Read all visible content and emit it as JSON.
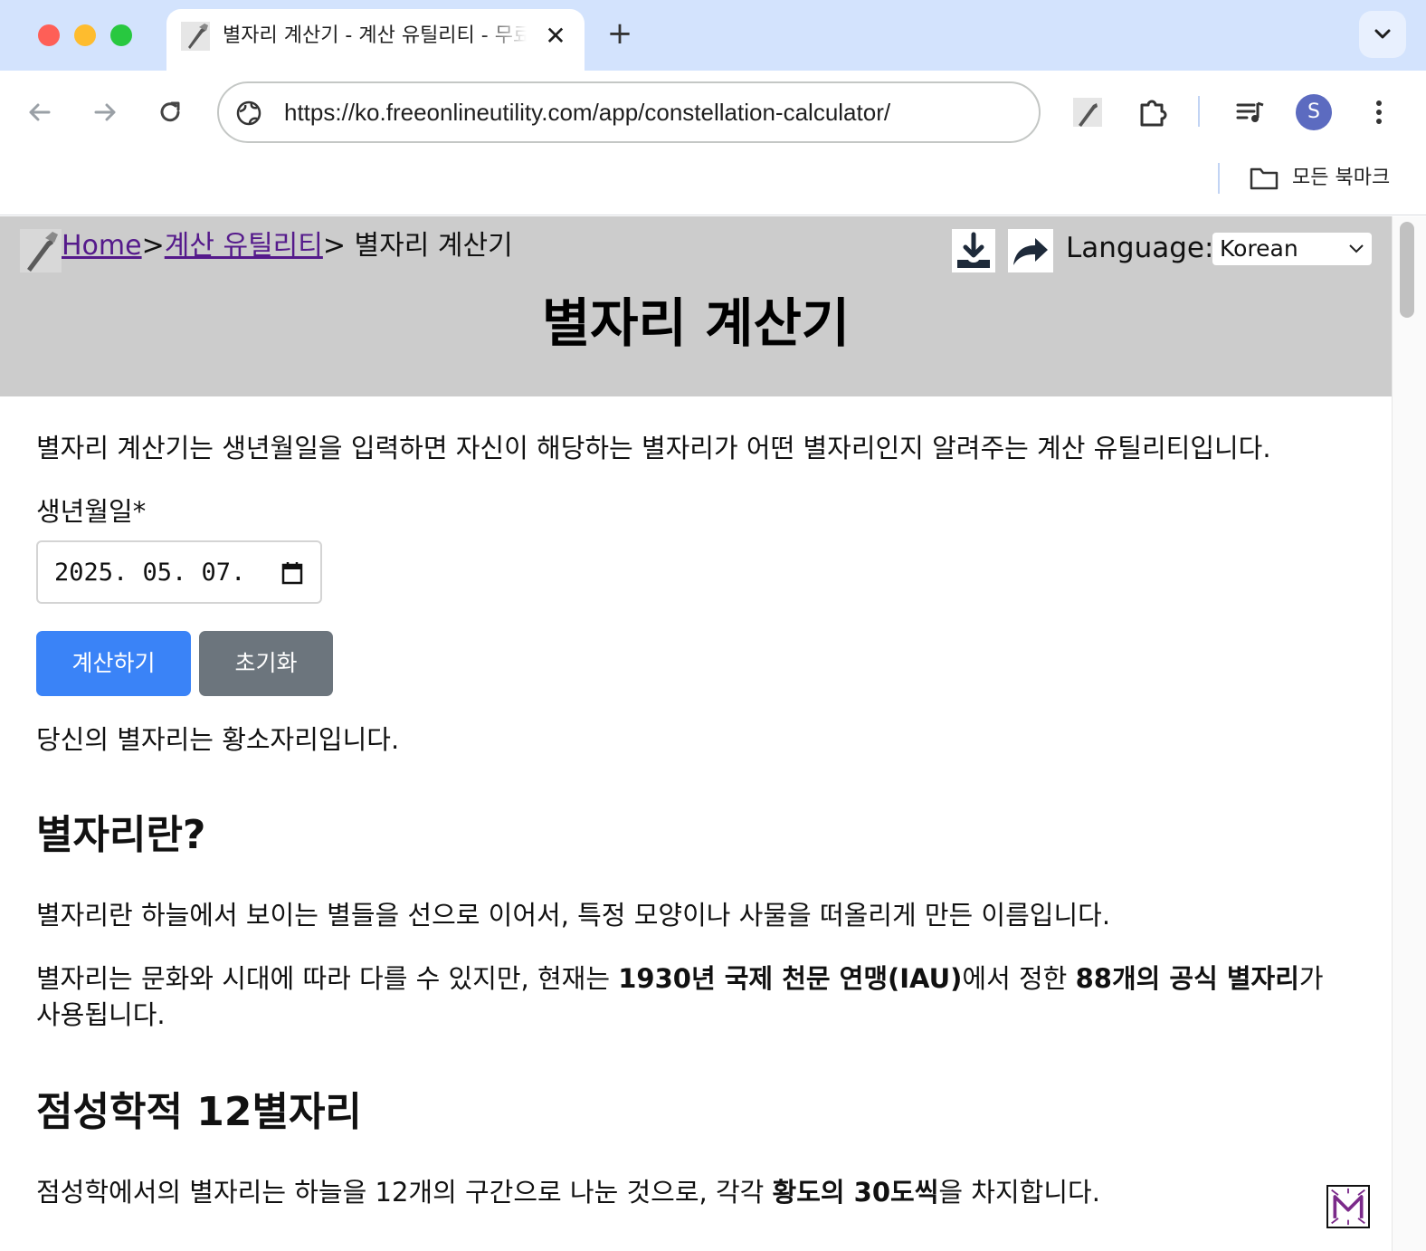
{
  "browser": {
    "tab_title": "별자리 계산기 - 계산 유틸리티 - 무료",
    "new_tab_label": "+",
    "close_label": "✕",
    "url": "https://ko.freeonlineutility.com/app/constellation-calculator/",
    "avatar_letter": "S",
    "bookmarks_label": "모든 북마크"
  },
  "header": {
    "breadcrumb_home": "Home",
    "breadcrumb_sep1": ">",
    "breadcrumb_category": "계산 유틸리티",
    "breadcrumb_current": "> 별자리 계산기",
    "language_label": "Language:",
    "language_value": "Korean",
    "page_title": "별자리 계산기"
  },
  "main": {
    "intro": "별자리 계산기는 생년월일을 입력하면 자신이 해당하는 별자리가 어떤 별자리인지 알려주는 계산 유틸리티입니다.",
    "birthdate_label": "생년월일*",
    "birthdate_value": "2025. 05. 07.",
    "calculate_button": "계산하기",
    "reset_button": "초기화",
    "result": "당신의 별자리는 황소자리입니다.",
    "section1_title": "별자리란?",
    "section1_p1": "별자리란 하늘에서 보이는 별들을 선으로 이어서, 특정 모양이나 사물을 떠올리게 만든 이름입니다.",
    "section1_p2_a": "별자리는 문화와 시대에 따라 다를 수 있지만, 현재는 ",
    "section1_p2_b": "1930년 국제 천문 연맹(IAU)",
    "section1_p2_c": "에서 정한 ",
    "section1_p2_d": "88개의 공식 별자리",
    "section1_p2_e": "가",
    "section1_p2_f": "사용됩니다.",
    "section2_title": "점성학적 12별자리",
    "section2_p1_a": "점성학에서의 별자리는 하늘을 12개의 구간으로 나눈 것으로, 각각 ",
    "section2_p1_b": "황도의 30도씩",
    "section2_p1_c": "을 차지합니다."
  },
  "colors": {
    "header_bg": "#cccccc",
    "link": "#551a8b",
    "primary_button": "#3a83f7",
    "secondary_button": "#6c757d",
    "tabstrip": "#d3e3fd"
  }
}
